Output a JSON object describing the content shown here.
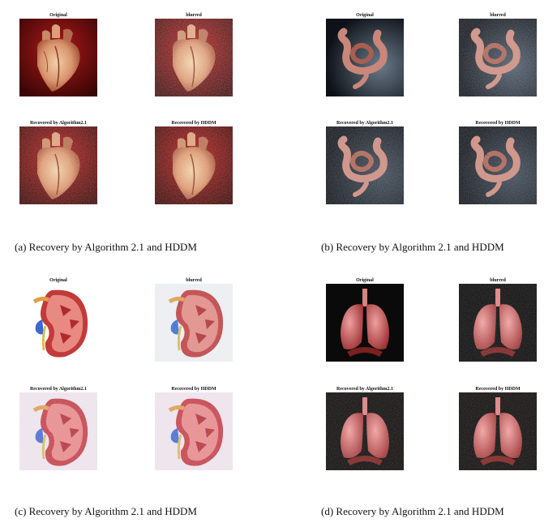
{
  "panels": [
    {
      "id": "a",
      "caption": "(a) Recovery by Algorithm 2.1 and HDDM",
      "subject": "heart",
      "cells": [
        {
          "title": "Original",
          "variant": "clean"
        },
        {
          "title": "blurred",
          "variant": "noisy"
        },
        {
          "title": "Recovered by Algorithm2.1",
          "variant": "recovered"
        },
        {
          "title": "Recovered by HDDM",
          "variant": "recovered"
        }
      ]
    },
    {
      "id": "b",
      "caption": "(b) Recovery by Algorithm 2.1 and HDDM",
      "subject": "intestine",
      "cells": [
        {
          "title": "Original",
          "variant": "clean"
        },
        {
          "title": "blurred",
          "variant": "noisy"
        },
        {
          "title": "Recovered by Algorithm2.1",
          "variant": "recovered"
        },
        {
          "title": "Recovered by HDDM",
          "variant": "recovered"
        }
      ]
    },
    {
      "id": "c",
      "caption": "(c) Recovery by Algorithm 2.1 and HDDM",
      "subject": "kidney",
      "cells": [
        {
          "title": "Original",
          "variant": "clean"
        },
        {
          "title": "blurred",
          "variant": "noisy"
        },
        {
          "title": "Recovered by Algorithm2.1",
          "variant": "recovered"
        },
        {
          "title": "Recovered by HDDM",
          "variant": "recovered"
        }
      ]
    },
    {
      "id": "d",
      "caption": "(d) Recovery by Algorithm 2.1 and HDDM",
      "subject": "lungs",
      "cells": [
        {
          "title": "Original",
          "variant": "clean"
        },
        {
          "title": "blurred",
          "variant": "noisy"
        },
        {
          "title": "Recovered by Algorithm2.1",
          "variant": "recovered"
        },
        {
          "title": "Recovered by HDDM",
          "variant": "recovered"
        }
      ]
    }
  ]
}
